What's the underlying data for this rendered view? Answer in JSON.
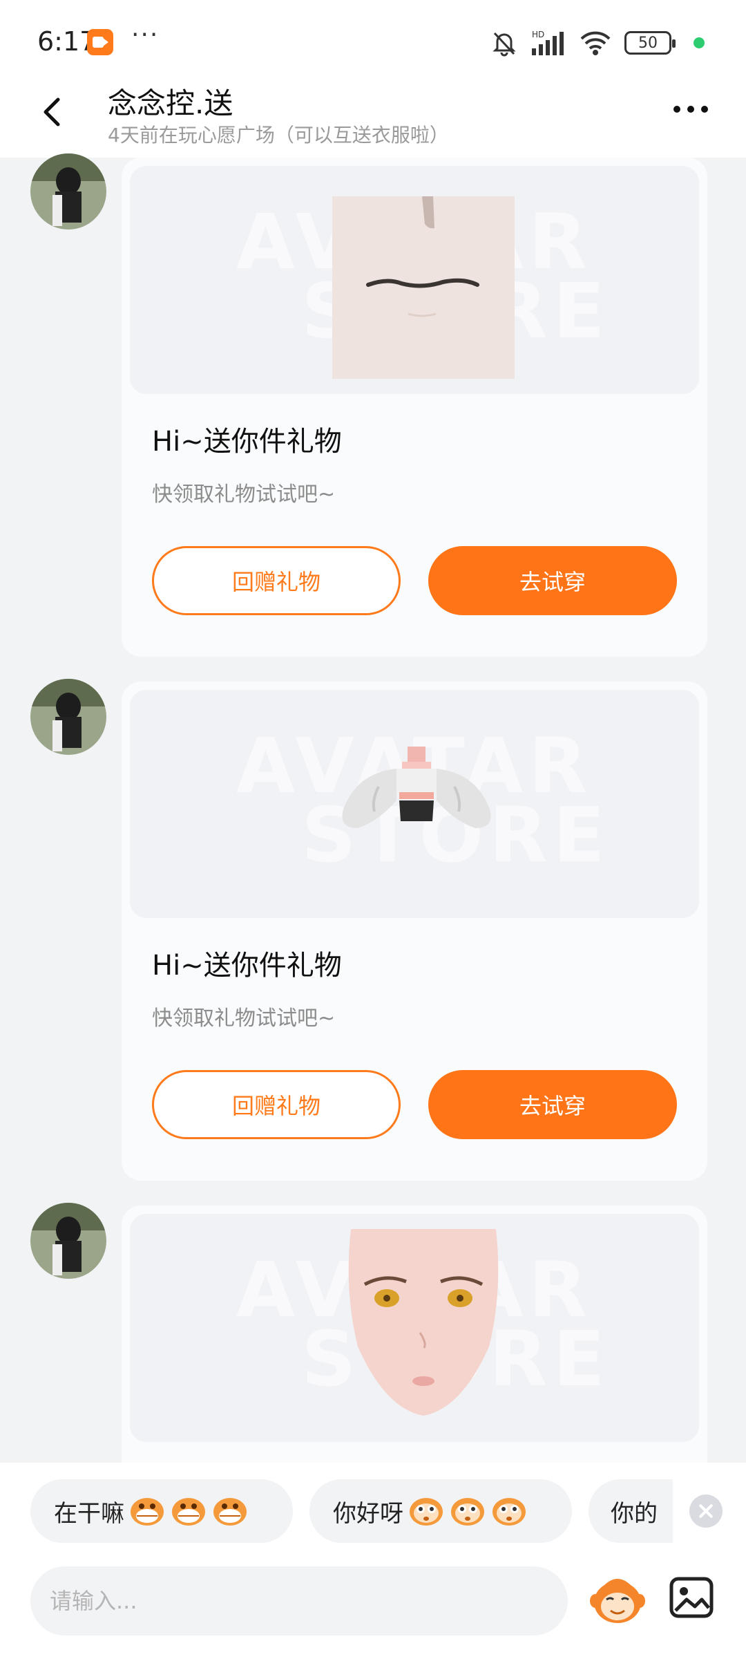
{
  "status_bar": {
    "time": "6:17",
    "dots": "···",
    "battery": "50",
    "network": "HD"
  },
  "header": {
    "title": "念念控.送",
    "subtitle": "4天前在玩心愿广场（可以互送衣服啦）"
  },
  "messages": [
    {
      "item_icon": "mouth-face-item",
      "watermark_line1": "AVATAR",
      "watermark_line2": "STORE",
      "title": "Hi~送你件礼物",
      "desc": "快领取礼物试试吧~",
      "return_label": "回赠礼物",
      "try_label": "去试穿"
    },
    {
      "item_icon": "fur-jacket-item",
      "watermark_line1": "AVATAR",
      "watermark_line2": "STORE",
      "title": "Hi~送你件礼物",
      "desc": "快领取礼物试试吧~",
      "return_label": "回赠礼物",
      "try_label": "去试穿"
    },
    {
      "item_icon": "face-item",
      "watermark_line1": "AVATAR",
      "watermark_line2": "STORE"
    }
  ],
  "quick_replies": [
    {
      "text": "在干嘛"
    },
    {
      "text": "你好呀"
    },
    {
      "text": "你的"
    }
  ],
  "input": {
    "placeholder": "请输入..."
  },
  "colors": {
    "accent": "#ff7417",
    "background": "#f2f3f5",
    "card": "#fafbfc"
  }
}
